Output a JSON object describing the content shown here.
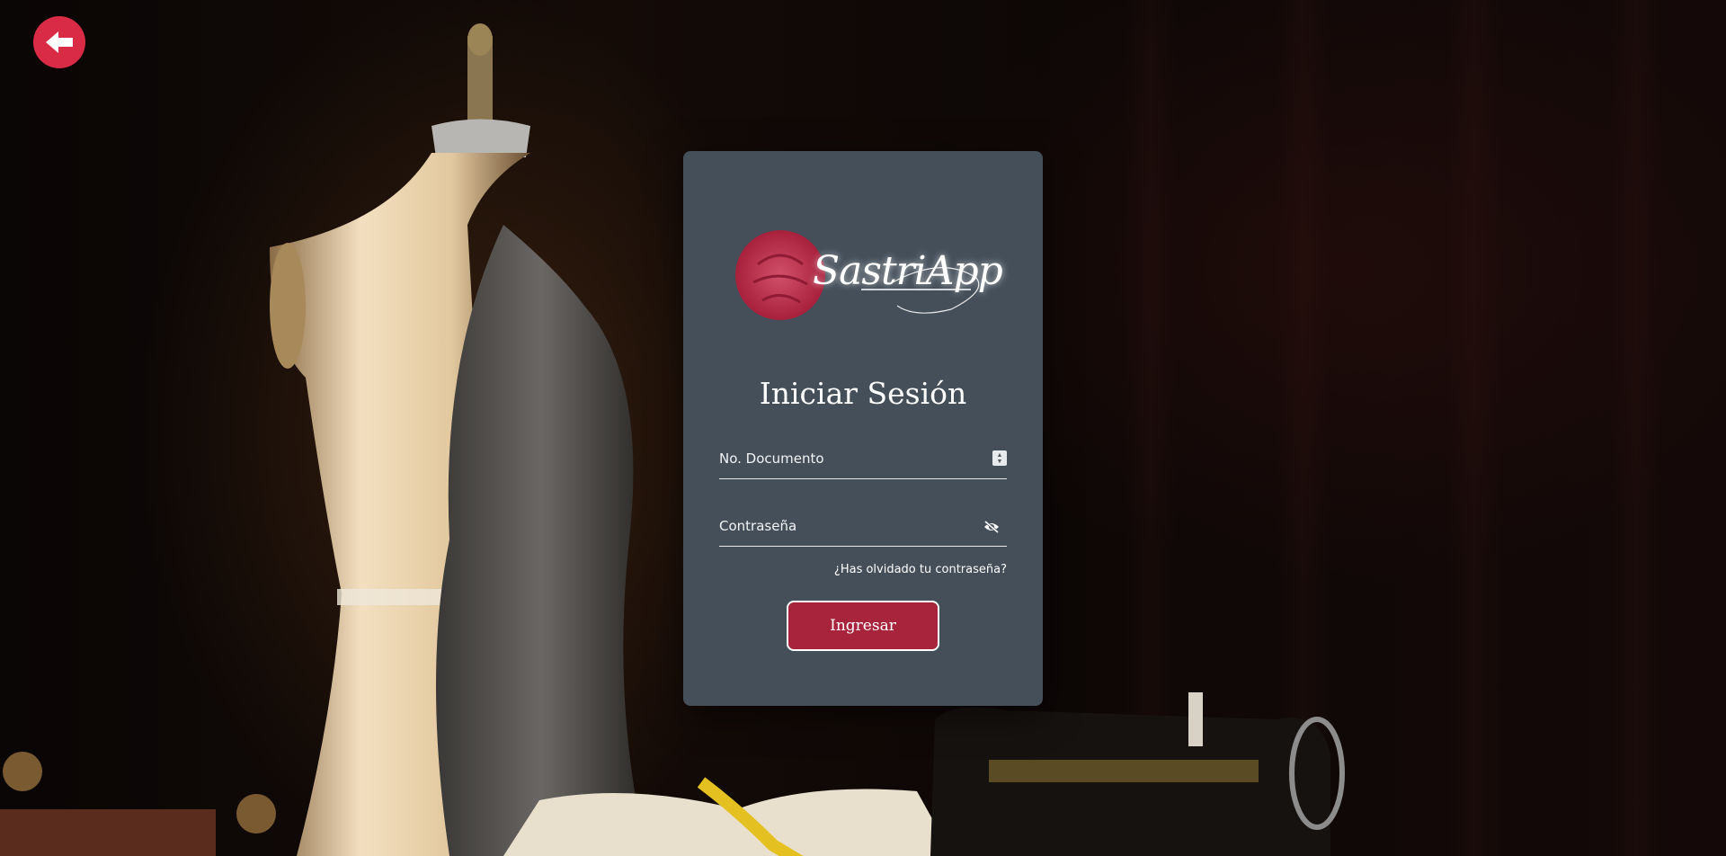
{
  "app": {
    "name": "SastriApp"
  },
  "nav": {
    "back_icon": "arrow-left-icon"
  },
  "login": {
    "title": "Iniciar Sesión",
    "document_field": {
      "placeholder": "No. Documento",
      "value": ""
    },
    "password_field": {
      "placeholder": "Contraseña",
      "value": "",
      "toggle_icon": "eye-slash-icon"
    },
    "forgot_link": "¿Has olvidado tu contraseña?",
    "submit_label": "Ingresar"
  },
  "colors": {
    "accent": "#d92b45",
    "button": "#a8243d",
    "card": "#47525e"
  }
}
